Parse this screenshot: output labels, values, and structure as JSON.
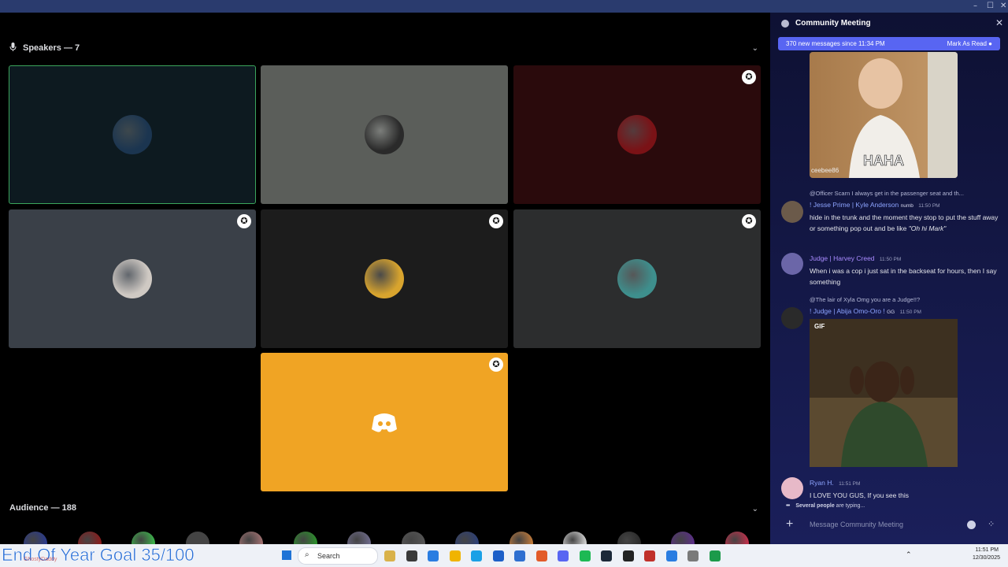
{
  "stage": {
    "speakers_label": "Speakers — 7",
    "audience_label": "Audience — 188",
    "tiles": [
      {
        "bg": "#0d1a20",
        "avatar_color": "#1b3550",
        "active": true,
        "badge": false
      },
      {
        "bg": "#5b5e5a",
        "avatar_color": "#2a2a2a",
        "active": false,
        "badge": false
      },
      {
        "bg": "#2a0a0c",
        "avatar_color": "#7a1216",
        "active": false,
        "badge": true
      },
      {
        "bg": "#3a4048",
        "avatar_color": "#cfc9c3",
        "active": false,
        "badge": true
      },
      {
        "bg": "#1c1c1c",
        "avatar_color": "#d8a42e",
        "active": false,
        "badge": true
      },
      {
        "bg": "#2c2d2e",
        "avatar_color": "#3e8f8d",
        "active": false,
        "badge": true
      },
      {
        "bg": "#f0a424",
        "avatar_color": "#f0a424",
        "active": false,
        "badge": true
      }
    ],
    "audience_colors": [
      "#2a3a8c",
      "#8a1b1b",
      "#3bb34a",
      "#444",
      "#a07070",
      "#2b8f2b",
      "#6d6a8a",
      "#555",
      "#2c3f77",
      "#c07a3a",
      "#cfcfcf",
      "#2a2a2a",
      "#5b2f88",
      "#c0304a"
    ]
  },
  "overlay": {
    "goal_text": "End Of Year Goal 35/100",
    "streamer_tag": "GhostyDaddy"
  },
  "chat": {
    "title": "Community Meeting",
    "new_messages": "370 new messages since 11:34 PM",
    "mark_read": "Mark As Read",
    "gif1_caption": "HAHA",
    "gif1_watermark": "ceebee86",
    "messages": [
      {
        "reply": "@Officer Scarn I always get in the passenger seat and th...",
        "name": "! Jesse Prime | Kyle Anderson",
        "tag": "numb",
        "time": "11:50 PM",
        "text": "hide in the trunk and the moment they stop to put the stuff away or something pop out and be like",
        "quote": "\"Oh hi Mark\"",
        "name_color": "#8da4ff"
      },
      {
        "name": "Judge | Harvey Creed",
        "time": "11:50 PM",
        "text": "When i was a cop i just sat in the backseat for hours, then I say something",
        "name_color": "#a98bff"
      },
      {
        "reply": "@The lair of Xyla Omg you are a Judge!!?",
        "name": "! Judge | Abija Omo-Oro !",
        "tag": "GG",
        "time": "11:50 PM",
        "name_color": "#8da4ff",
        "gif_label": "GIF"
      },
      {
        "name": "Ryan H.",
        "time": "11:51 PM",
        "text": "I LOVE YOU GUS, If you see this",
        "name_color": "#8da4ff"
      }
    ],
    "typing_bold": "Several people",
    "typing_rest": " are typing...",
    "composer_placeholder": "Message Community Meeting"
  },
  "taskbar": {
    "search_placeholder": "Search",
    "time": "11:51 PM",
    "date": "12/30/2025"
  }
}
